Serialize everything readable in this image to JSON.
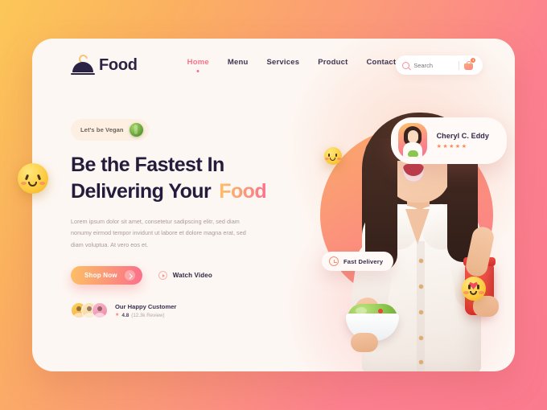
{
  "brand": {
    "name": "Food",
    "logo_icon": "food-cloche-icon"
  },
  "nav": {
    "items": [
      {
        "label": "Home",
        "active": true
      },
      {
        "label": "Menu",
        "active": false
      },
      {
        "label": "Services",
        "active": false
      },
      {
        "label": "Product",
        "active": false
      },
      {
        "label": "Contact",
        "active": false
      }
    ]
  },
  "search": {
    "placeholder": "Search",
    "icon": "search-icon"
  },
  "cart": {
    "icon": "shopping-cart-icon",
    "badge": "1"
  },
  "hero": {
    "badge": {
      "label": "Let's be Vegan",
      "icon": "lettuce-emoji"
    },
    "headline_line1": "Be the Fastest In",
    "headline_line2": "Delivering Your",
    "headline_accent": "Food",
    "body": "Lorem ipsum dolor sit amet, consetetur sadipscing elitr, sed diam nonumy eirmod tempor invidunt ut labore et dolore magna erat, sed diam voluptua. At vero eos et.",
    "primary_button": {
      "label": "Shop Now",
      "icon": "arrow-right-icon"
    },
    "secondary_button": {
      "label": "Watch Video",
      "icon": "play-icon"
    }
  },
  "social_proof": {
    "title": "Our Happy Customer",
    "score": "4.8",
    "reviews": "(12.3k Review)",
    "star": "★",
    "avatar_count": 3
  },
  "testimonial": {
    "name": "Cheryl C. Eddy",
    "stars": [
      "★",
      "★",
      "★",
      "★",
      "★"
    ]
  },
  "delivery_badge": {
    "label": "Fast Delivery",
    "icon": "clock-icon"
  },
  "stickers": [
    {
      "name": "winking-emoji-left"
    },
    {
      "name": "smiling-emoji-face"
    },
    {
      "name": "heart-eyes-emoji-right"
    }
  ],
  "colors": {
    "bg_gradient_start": "#fcc758",
    "bg_gradient_end": "#fb7b8e",
    "card_bg": "#fdf7f3",
    "heading": "#231c3d",
    "accent_pink": "#fb6f8b",
    "accent_orange": "#fcbf67",
    "body_text": "#a79a96"
  }
}
